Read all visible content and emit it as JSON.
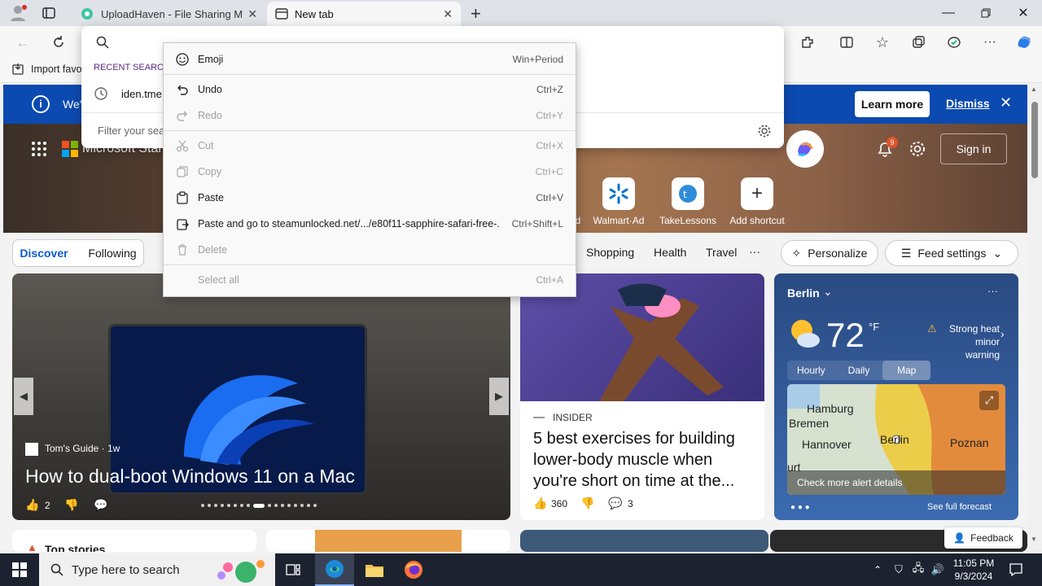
{
  "tabs": [
    {
      "title": "UploadHaven - File Sharing Made Simple",
      "icon": "uploadhaven-favicon"
    },
    {
      "title": "New tab",
      "icon": "newtab-icon"
    }
  ],
  "favorites_bar": {
    "import_label": "Import favo"
  },
  "banner": {
    "text": "We'",
    "learn_more": "Learn more",
    "dismiss": "Dismiss"
  },
  "omnibox": {
    "recent_heading": "RECENT SEARCH",
    "recent_item": "iden.tme",
    "filter_placeholder": "Filter your sea"
  },
  "context_menu": {
    "items": [
      {
        "label": "Emoji",
        "shortcut": "Win+Period",
        "enabled": true,
        "icon": "emoji-icon"
      },
      {
        "label": "Undo",
        "shortcut": "Ctrl+Z",
        "enabled": true,
        "icon": "undo-icon"
      },
      {
        "label": "Redo",
        "shortcut": "Ctrl+Y",
        "enabled": false,
        "icon": "redo-icon"
      },
      {
        "label": "Cut",
        "shortcut": "Ctrl+X",
        "enabled": false,
        "icon": "cut-icon"
      },
      {
        "label": "Copy",
        "shortcut": "Ctrl+C",
        "enabled": false,
        "icon": "copy-icon"
      },
      {
        "label": "Paste",
        "shortcut": "Ctrl+V",
        "enabled": true,
        "icon": "paste-icon"
      },
      {
        "label": "Paste and go to steamunlocked.net/.../e80f11-sapphire-safari-free-...",
        "shortcut": "Ctrl+Shift+L",
        "enabled": true,
        "icon": "paste-go-icon"
      },
      {
        "label": "Delete",
        "shortcut": "",
        "enabled": false,
        "icon": "delete-icon"
      },
      {
        "label": "Select all",
        "shortcut": "Ctrl+A",
        "enabled": false,
        "icon": ""
      }
    ]
  },
  "header": {
    "brand": "Microsoft Start",
    "notif_count": "9",
    "sign_in": "Sign in"
  },
  "shortcuts": [
    {
      "label": "d"
    },
    {
      "label": "Walmart·Ad"
    },
    {
      "label": "TakeLessons"
    },
    {
      "label": "Add shortcut"
    }
  ],
  "feed_nav": {
    "discover": "Discover",
    "following": "Following",
    "categories": [
      "Shopping",
      "Health",
      "Travel"
    ],
    "more": "···",
    "personalize": "Personalize",
    "feed_settings": "Feed settings"
  },
  "hero_card": {
    "source": "Tom's Guide · 1w",
    "title": "How to dual-boot Windows 11 on a Mac",
    "likes": "2"
  },
  "article_card": {
    "source": "INSIDER",
    "title": "5 best exercises for building lower-body muscle when you're short on time at the...",
    "likes": "360",
    "comments": "3"
  },
  "weather": {
    "city": "Berlin",
    "temp": "72",
    "unit": "°F",
    "alert": "Strong heat minor warning",
    "tabs": [
      "Hourly",
      "Daily",
      "Map"
    ],
    "active_tab": "Map",
    "map_labels": [
      "Hamburg",
      "Bremen",
      "Hannover",
      "Berlin",
      "Poznan",
      "urt"
    ],
    "alert_details": "Check more alert details",
    "full_forecast": "See full forecast"
  },
  "bottom": {
    "top_stories": "Top stories",
    "feedback": "Feedback"
  },
  "taskbar": {
    "search_placeholder": "Type here to search",
    "time": "11:05 PM",
    "date": "9/3/2024"
  }
}
